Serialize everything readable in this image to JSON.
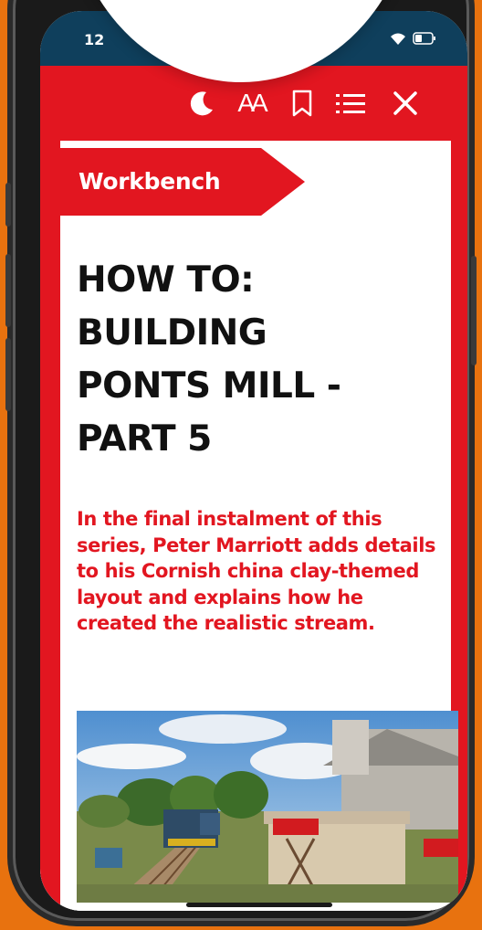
{
  "status": {
    "time": "12",
    "icons": [
      "wifi-icon",
      "battery-icon"
    ]
  },
  "toolbar": {
    "icons": [
      "moon-icon",
      "text-size-icon",
      "bookmark-icon",
      "list-icon",
      "close-icon"
    ],
    "text_size_label": "AA"
  },
  "article": {
    "category": "Workbench",
    "headline_lines": [
      "HOW TO:",
      "BUILDING",
      "PONTS MILL -",
      "PART 5"
    ],
    "standfirst": "In the final instalment of this series, Peter Marriott adds details to his Cornish china clay-themed layout and explains how he created the realistic stream."
  },
  "colors": {
    "brand_red": "#e21620",
    "background_orange": "#e8720f",
    "status_bar": "#0f3f5c",
    "headline": "#111111"
  }
}
